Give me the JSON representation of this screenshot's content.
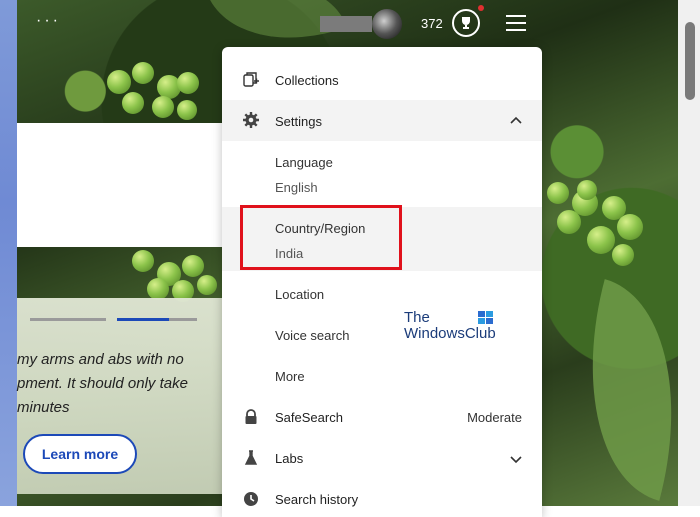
{
  "topbar": {
    "more_dots": "···",
    "points": "372"
  },
  "card": {
    "text_line1": "my arms and abs with no",
    "text_line2": "pment. It should only take",
    "text_line3": "minutes",
    "learn_more": "Learn more"
  },
  "menu": {
    "collections": "Collections",
    "settings": "Settings",
    "language_label": "Language",
    "language_value": "English",
    "country_label": "Country/Region",
    "country_value": "India",
    "location": "Location",
    "voice_search": "Voice search",
    "more": "More",
    "safesearch_label": "SafeSearch",
    "safesearch_value": "Moderate",
    "labs": "Labs",
    "search_history": "Search history"
  },
  "watermark": {
    "line1": "The",
    "line2": "WindowsClub"
  },
  "colors": {
    "accent_blue": "#1c49b8",
    "highlight_red": "#e0111b",
    "notification": "#e03030"
  }
}
